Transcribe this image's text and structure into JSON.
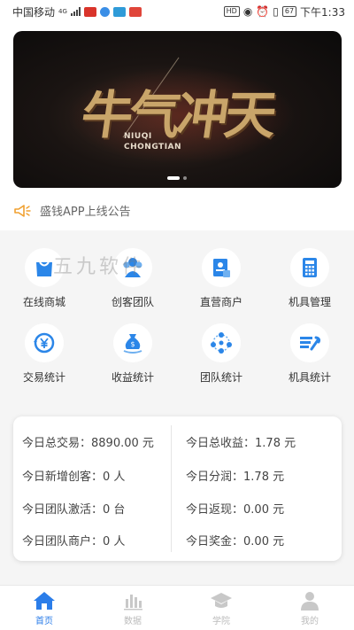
{
  "status_bar": {
    "carrier": "中国移动",
    "network": "4G",
    "battery": "67",
    "hd": "HD",
    "time": "下午1:33"
  },
  "banner": {
    "title": "牛气冲天",
    "subtitle_line1": "NIUQI",
    "subtitle_line2": "CHONGTIAN",
    "slide_count": 2,
    "active_slide": 1
  },
  "notice": {
    "text": "盛钱APP上线公告",
    "icon": "megaphone-icon"
  },
  "watermark": "五九软件",
  "menu": [
    {
      "label": "在线商城",
      "icon": "shopping-bag-icon"
    },
    {
      "label": "创客团队",
      "icon": "team-icon"
    },
    {
      "label": "直营商户",
      "icon": "merchant-card-icon"
    },
    {
      "label": "机具管理",
      "icon": "calculator-icon"
    },
    {
      "label": "交易统计",
      "icon": "exchange-yen-icon"
    },
    {
      "label": "收益统计",
      "icon": "money-bag-icon"
    },
    {
      "label": "团队统计",
      "icon": "network-icon"
    },
    {
      "label": "机具统计",
      "icon": "tools-icon"
    }
  ],
  "stats": {
    "left": [
      {
        "label": "今日总交易：",
        "value": "8890.00 元"
      },
      {
        "label": "今日新增创客：",
        "value": "0 人"
      },
      {
        "label": "今日团队激活：",
        "value": "0 台"
      },
      {
        "label": "今日团队商户：",
        "value": "0 人"
      }
    ],
    "right": [
      {
        "label": "今日总收益：",
        "value": "1.78 元"
      },
      {
        "label": "今日分润：",
        "value": "1.78 元"
      },
      {
        "label": "今日返现：",
        "value": "0.00 元"
      },
      {
        "label": "今日奖金：",
        "value": "0.00 元"
      }
    ]
  },
  "tabs": [
    {
      "label": "首页",
      "icon": "home-icon",
      "active": true
    },
    {
      "label": "数据",
      "icon": "bar-chart-icon",
      "active": false
    },
    {
      "label": "学院",
      "icon": "graduation-cap-icon",
      "active": false
    },
    {
      "label": "我的",
      "icon": "user-icon",
      "active": false
    }
  ],
  "colors": {
    "accent": "#2b7de9",
    "notice_icon": "#f0a030",
    "banner_gold": "#c9a56a"
  }
}
